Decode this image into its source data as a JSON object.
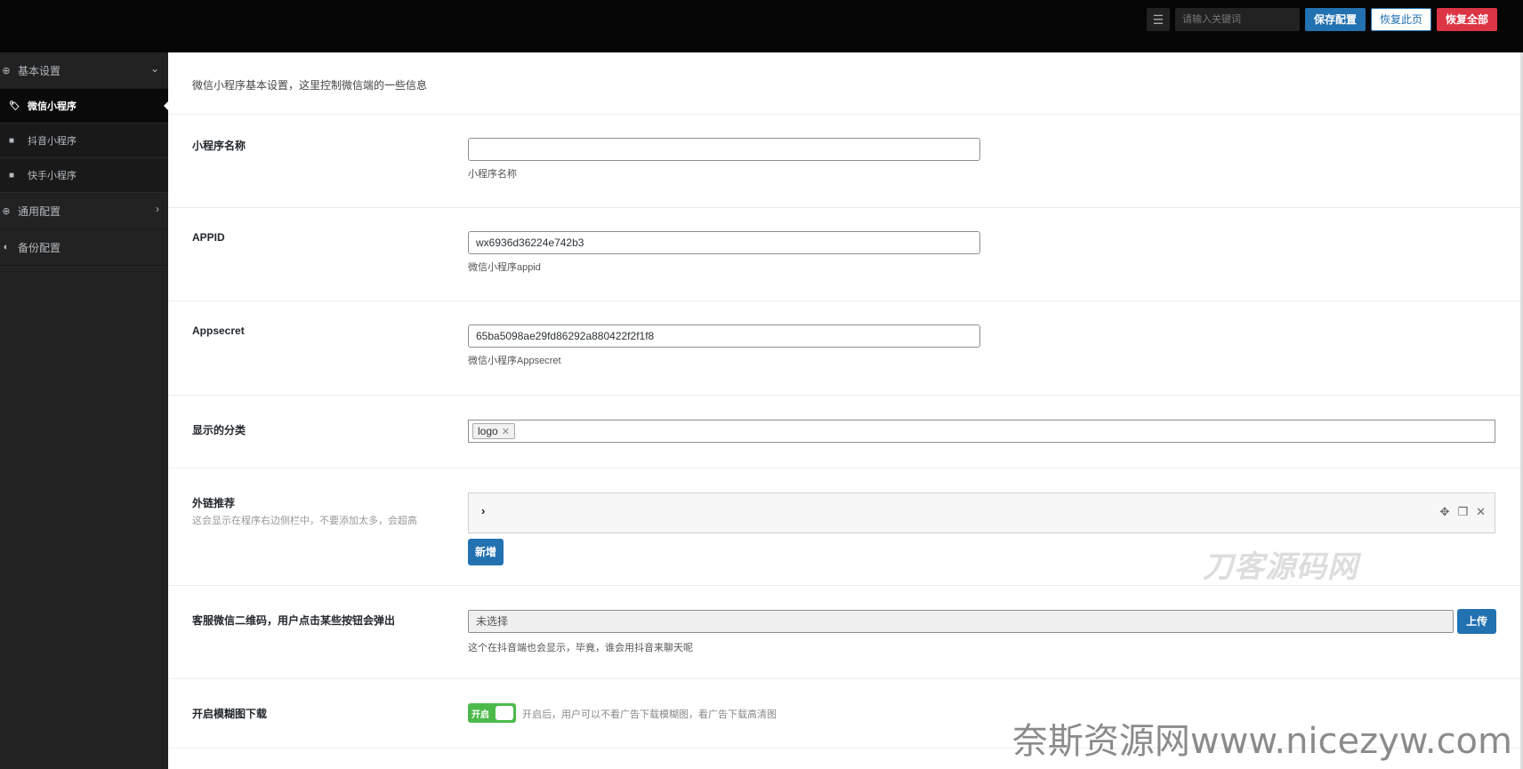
{
  "header": {
    "search_placeholder": "请输入关键词",
    "save_label": "保存配置",
    "reset_page_label": "恢复此页",
    "reset_all_label": "恢复全部"
  },
  "sidebar": {
    "basic": {
      "label": "基本设置",
      "icon": "plus-circle-icon"
    },
    "subitems": [
      {
        "label": "微信小程序",
        "icon": "tag-icon",
        "active": true
      },
      {
        "label": "抖音小程序",
        "icon": "video-icon",
        "active": false
      },
      {
        "label": "快手小程序",
        "icon": "video-icon",
        "active": false
      }
    ],
    "general": {
      "label": "通用配置",
      "icon": "plus-circle-icon"
    },
    "backup": {
      "label": "备份配置",
      "icon": "shield-icon"
    }
  },
  "main": {
    "notice": "微信小程序基本设置，这里控制微信端的一些信息",
    "fields": {
      "name": {
        "title": "小程序名称",
        "value": "",
        "desc": "小程序名称"
      },
      "appid": {
        "title": "APPID",
        "value": "wx6936d36224e742b3",
        "desc": "微信小程序appid"
      },
      "appsecret": {
        "title": "Appsecret",
        "value": "65ba5098ae29fd86292a880422f2f1f8",
        "desc": "微信小程序Appsecret"
      },
      "categories": {
        "title": "显示的分类",
        "chips": [
          "logo"
        ]
      },
      "links": {
        "title": "外链推荐",
        "subtitle": "这会显示在程序右边侧栏中，不要添加太多，会超高",
        "add_label": "新增"
      },
      "qrcode": {
        "title": "客服微信二维码，用户点击某些按钮会弹出",
        "value": "未选择",
        "upload_label": "上传",
        "desc": "这个在抖音端也会显示，毕竟，谁会用抖音来聊天呢"
      },
      "blur": {
        "title": "开启模糊图下载",
        "switch_label": "开启",
        "switch_on": true,
        "desc": "开启后，用户可以不看广告下载模糊图，看广告下载高清图"
      }
    }
  },
  "watermarks": {
    "center": "刀客源码网",
    "corner": "奈斯资源网www.nicezyw.com"
  }
}
